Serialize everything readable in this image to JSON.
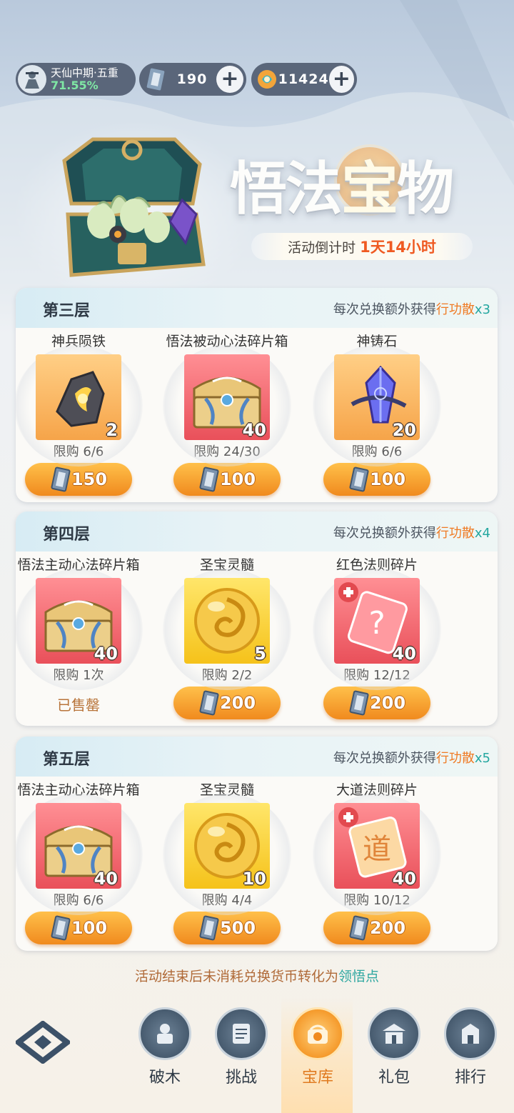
{
  "player": {
    "realm": "天仙中期·五重",
    "progress": "71.55%"
  },
  "currencies": [
    {
      "icon": "token-ticket-icon",
      "value": "190"
    },
    {
      "icon": "spirit-coin-icon",
      "value": "11424"
    }
  ],
  "event": {
    "title_parts": [
      "悟法",
      "宝",
      "物"
    ],
    "countdown_label": "活动倒计时",
    "countdown_value": "1天14小时"
  },
  "bonus_text": {
    "prefix": "每次兑换额外获得",
    "item": "行功散",
    "x": "x"
  },
  "tiers": [
    {
      "name": "第三层",
      "bonus_multiplier": "3",
      "items": [
        {
          "name": "神兵陨铁",
          "qty": "2",
          "limit": "限购 6/6",
          "price": "150",
          "card": "orange",
          "icon": "meteor-iron-icon"
        },
        {
          "name": "悟法被动心法碎片箱",
          "qty": "40",
          "limit": "限购 24/30",
          "price": "100",
          "card": "red",
          "icon": "treasure-chest-icon"
        },
        {
          "name": "神铸石",
          "qty": "20",
          "limit": "限购 6/6",
          "price": "100",
          "card": "orange",
          "icon": "crystal-icon"
        }
      ]
    },
    {
      "name": "第四层",
      "bonus_multiplier": "4",
      "items": [
        {
          "name": "悟法主动心法碎片箱",
          "qty": "40",
          "limit": "限购 1次",
          "sold_out": "已售罄",
          "card": "red",
          "icon": "treasure-chest-icon"
        },
        {
          "name": "圣宝灵髓",
          "qty": "5",
          "limit": "限购 2/2",
          "price": "200",
          "card": "gold",
          "icon": "golden-orb-icon"
        },
        {
          "name": "红色法则碎片",
          "qty": "40",
          "limit": "限购 12/12",
          "price": "200",
          "card": "red",
          "icon": "mystery-shard-icon"
        }
      ]
    },
    {
      "name": "第五层",
      "bonus_multiplier": "5",
      "items": [
        {
          "name": "悟法主动心法碎片箱",
          "qty": "40",
          "limit": "限购 6/6",
          "price": "100",
          "card": "red",
          "icon": "treasure-chest-icon"
        },
        {
          "name": "圣宝灵髓",
          "qty": "10",
          "limit": "限购 4/4",
          "price": "500",
          "card": "gold",
          "icon": "golden-orb-icon"
        },
        {
          "name": "大道法则碎片",
          "qty": "40",
          "limit": "限购 10/12",
          "price": "200",
          "card": "red",
          "icon": "dao-shard-icon"
        }
      ]
    }
  ],
  "footer_note": {
    "prefix": "活动结束后未消耗兑换货币转化为",
    "highlight": "领悟点"
  },
  "nav": {
    "tabs": [
      {
        "label": "破木",
        "icon": "dummy-icon"
      },
      {
        "label": "挑战",
        "icon": "scroll-icon"
      },
      {
        "label": "宝库",
        "icon": "treasury-icon",
        "active": true
      },
      {
        "label": "礼包",
        "icon": "gift-pavilion-icon"
      },
      {
        "label": "排行",
        "icon": "ranking-icon"
      }
    ]
  },
  "colors": {
    "accent": "#f08a1e",
    "teal": "#25a7a0",
    "title_orange": "#ef5a22"
  }
}
